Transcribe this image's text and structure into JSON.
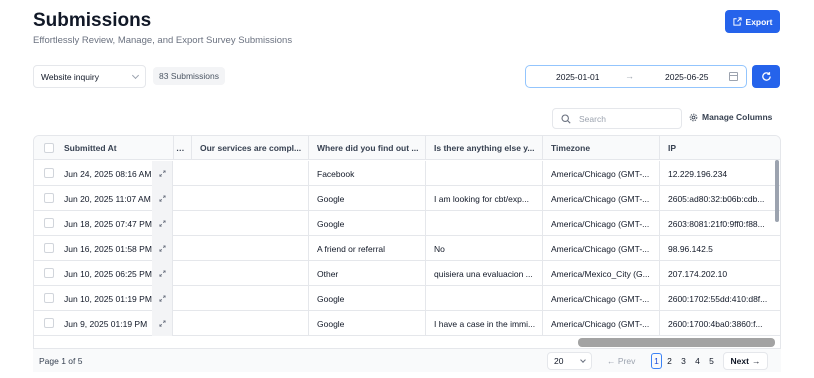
{
  "header": {
    "title": "Submissions",
    "subtitle": "Effortlessly Review, Manage, and Export Survey Submissions",
    "export_label": "Export"
  },
  "filters": {
    "form_select_value": "Website inquiry",
    "submissions_count": "83 Submissions",
    "date_from": "2025-01-01",
    "date_arrow": "→",
    "date_to": "2025-06-25"
  },
  "toolbar": {
    "search_placeholder": "Search",
    "manage_columns_label": "Manage Columns"
  },
  "table": {
    "columns": [
      "Submitted At",
      "…",
      "Our services are compl...",
      "Where did you find out ...",
      "Is there anything else y...",
      "Timezone",
      "IP"
    ],
    "rows": [
      {
        "submitted": "Jun 24, 2025 08:16 AM",
        "services": "",
        "source": "Facebook",
        "anything": "",
        "timezone": "America/Chicago (GMT-...",
        "ip": "12.229.196.234"
      },
      {
        "submitted": "Jun 20, 2025 11:07 AM",
        "services": "",
        "source": "Google",
        "anything": "I am looking for cbt/exp...",
        "timezone": "America/Chicago (GMT-...",
        "ip": "2605:ad80:32:b06b:cdb..."
      },
      {
        "submitted": "Jun 18, 2025 07:47 PM",
        "services": "",
        "source": "Google",
        "anything": "",
        "timezone": "America/Chicago (GMT-...",
        "ip": "2603:8081:21f0:9ff0:f88..."
      },
      {
        "submitted": "Jun 16, 2025 01:58 PM",
        "services": "",
        "source": "A friend or referral",
        "anything": "No",
        "timezone": "America/Chicago (GMT-...",
        "ip": "98.96.142.5"
      },
      {
        "submitted": "Jun 10, 2025 06:25 PM",
        "services": "",
        "source": "Other",
        "anything": "quisiera una evaluacion ...",
        "timezone": "America/Mexico_City (G...",
        "ip": "207.174.202.10"
      },
      {
        "submitted": "Jun 10, 2025 01:19 PM",
        "services": "",
        "source": "Google",
        "anything": "",
        "timezone": "America/Chicago (GMT-...",
        "ip": "2600:1702:55dd:410:d8f..."
      },
      {
        "submitted": "Jun 9, 2025 01:19 PM",
        "services": "",
        "source": "Google",
        "anything": "I have a case in the immi...",
        "timezone": "America/Chicago (GMT-...",
        "ip": "2600:1700:4ba0:3860:f..."
      }
    ]
  },
  "pagination": {
    "page_info": "Page 1 of 5",
    "page_size": "20",
    "prev_label": "Prev",
    "next_label": "Next",
    "pages": [
      "1",
      "2",
      "3",
      "4",
      "5"
    ],
    "current_page": "1"
  },
  "colors": {
    "accent": "#2563eb",
    "border": "#e5e7eb",
    "header_bg": "#f9fafb"
  }
}
